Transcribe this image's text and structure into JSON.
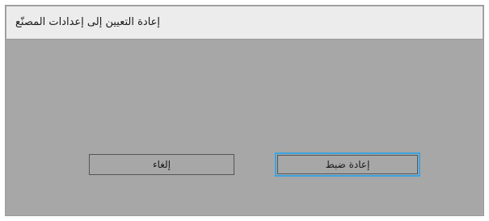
{
  "dialog": {
    "title": "إعادة التعيين إلى إعدادات المصنّع",
    "buttons": {
      "cancel_label": "إلغاء",
      "reset_label": "إعادة ضبط"
    }
  },
  "colors": {
    "dialog_background": "#a7a7a7",
    "title_bar_background": "#ececec",
    "focus_outline": "#3ba4e0"
  }
}
